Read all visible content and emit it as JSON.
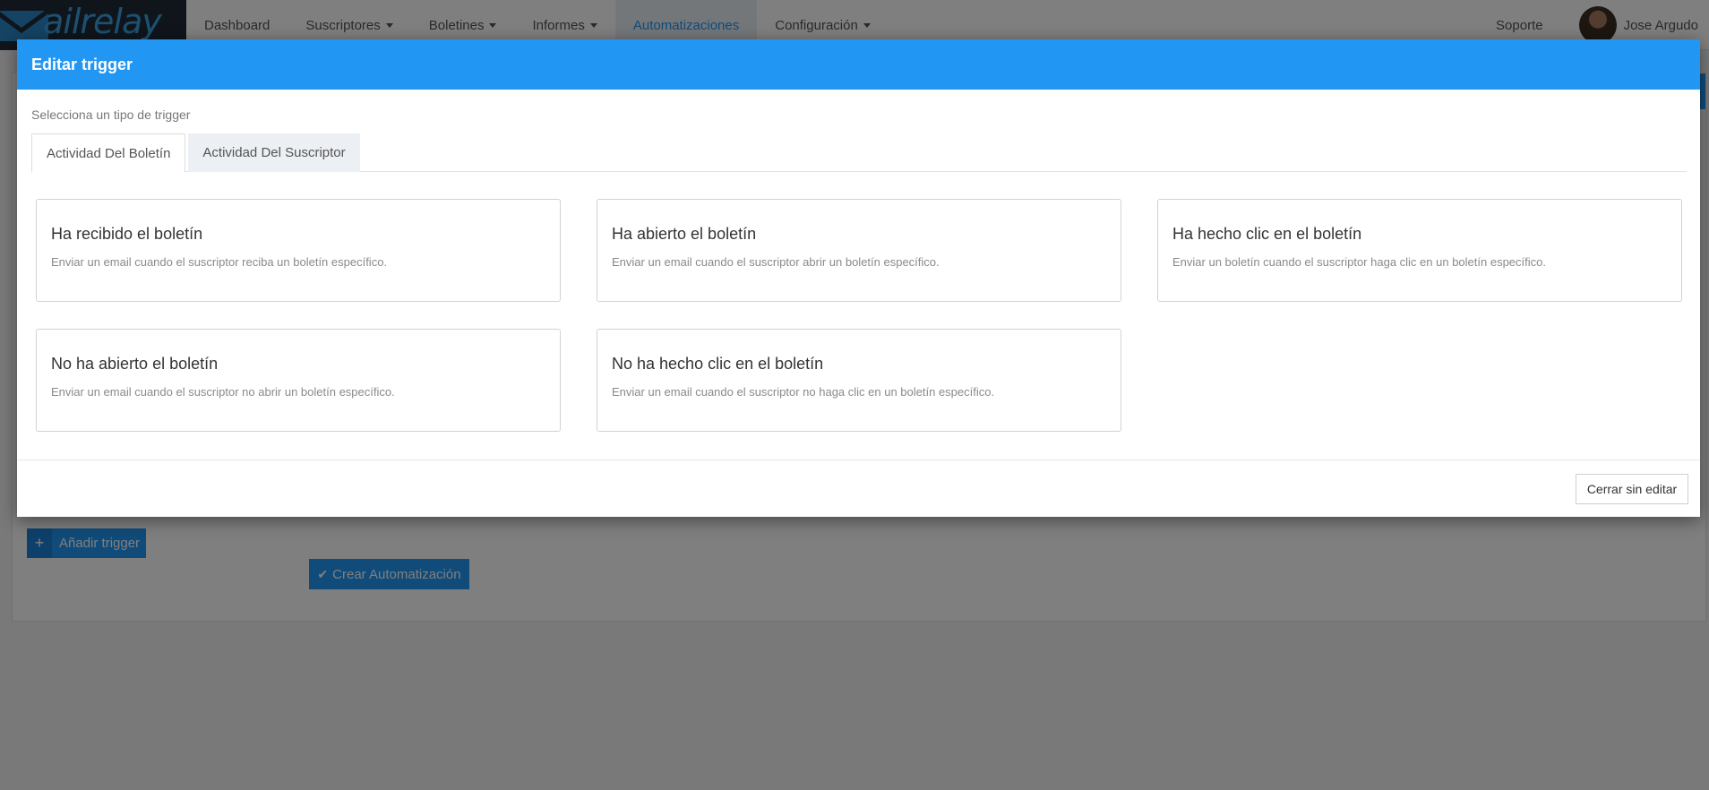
{
  "brand": {
    "logo_text": "ailrelay",
    "logo_mark_icon": "envelope-m-icon"
  },
  "nav": {
    "items": [
      {
        "label": "Dashboard",
        "dropdown": false,
        "active": false
      },
      {
        "label": "Suscriptores",
        "dropdown": true,
        "active": false
      },
      {
        "label": "Boletines",
        "dropdown": true,
        "active": false
      },
      {
        "label": "Informes",
        "dropdown": true,
        "active": false
      },
      {
        "label": "Automatizaciones",
        "dropdown": false,
        "active": true
      },
      {
        "label": "Configuración",
        "dropdown": true,
        "active": false
      }
    ],
    "support": "Soporte",
    "user_name": "Jose Argudo"
  },
  "background": {
    "add_trigger_label": "Añadir trigger",
    "create_automation_label": "Crear Automatización"
  },
  "modal": {
    "title": "Editar trigger",
    "select_label": "Selecciona un tipo de trigger",
    "tabs": [
      {
        "label": "Actividad Del Boletín",
        "active": true
      },
      {
        "label": "Actividad Del Suscriptor",
        "active": false
      }
    ],
    "cards": [
      {
        "title": "Ha recibido el boletín",
        "description": "Enviar un email cuando el suscriptor reciba un boletín específico."
      },
      {
        "title": "Ha abierto el boletín",
        "description": "Enviar un email cuando el suscriptor abrir un boletín específico."
      },
      {
        "title": "Ha hecho clic en el boletín",
        "description": "Enviar un boletín cuando el suscriptor haga clic en un boletín específico."
      },
      {
        "title": "No ha abierto el boletín",
        "description": "Enviar un email cuando el suscriptor no abrir un boletín específico."
      },
      {
        "title": "No ha hecho clic en el boletín",
        "description": "Enviar un email cuando el suscriptor no haga clic en un boletín específico."
      }
    ],
    "close_label": "Cerrar sin editar"
  },
  "colors": {
    "primary": "#2196f3",
    "overlay": "rgba(0,0,0,0.5)",
    "logo_bg": "#1f2a37"
  }
}
